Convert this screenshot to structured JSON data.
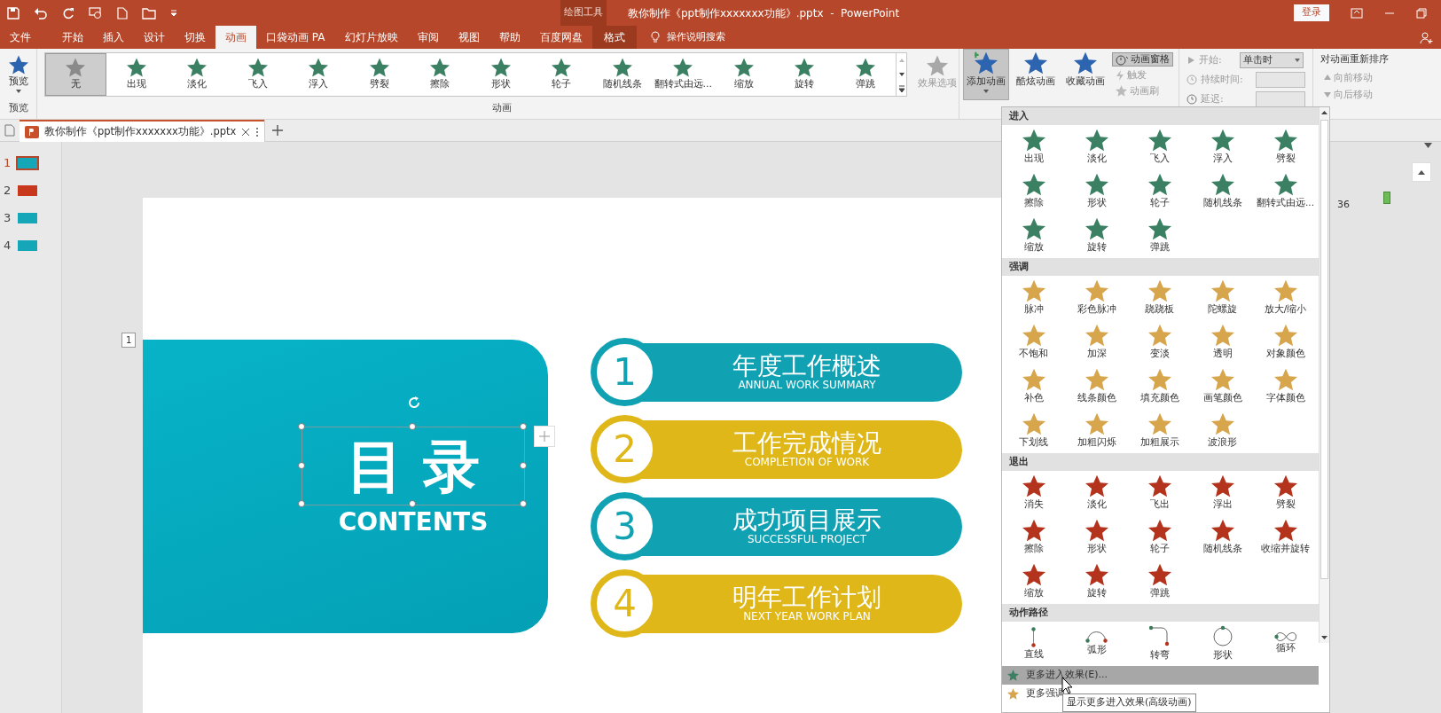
{
  "title_bar": {
    "context_label": "绘图工具",
    "title": "教你制作《ppt制作xxxxxxx功能》.pptx  -  PowerPoint",
    "login": "登录"
  },
  "tabs": [
    {
      "label": "文件",
      "selected": false,
      "kind": "file"
    },
    {
      "label": "开始",
      "selected": false,
      "kind": "normal"
    },
    {
      "label": "插入",
      "selected": false,
      "kind": "normal"
    },
    {
      "label": "设计",
      "selected": false,
      "kind": "normal"
    },
    {
      "label": "切换",
      "selected": false,
      "kind": "normal"
    },
    {
      "label": "动画",
      "selected": true,
      "kind": "normal"
    },
    {
      "label": "口袋动画 PA",
      "selected": false,
      "kind": "normal"
    },
    {
      "label": "幻灯片放映",
      "selected": false,
      "kind": "normal"
    },
    {
      "label": "审阅",
      "selected": false,
      "kind": "normal"
    },
    {
      "label": "视图",
      "selected": false,
      "kind": "normal"
    },
    {
      "label": "帮助",
      "selected": false,
      "kind": "normal"
    },
    {
      "label": "百度网盘",
      "selected": false,
      "kind": "normal"
    },
    {
      "label": "格式",
      "selected": false,
      "kind": "context"
    }
  ],
  "search": "操作说明搜索",
  "ribbon": {
    "preview": "预览",
    "preview_group": "预览",
    "gallery": [
      {
        "label": "无",
        "selected": true,
        "kind": "none"
      },
      {
        "label": "出现",
        "selected": false,
        "kind": "effect"
      },
      {
        "label": "淡化",
        "selected": false,
        "kind": "effect"
      },
      {
        "label": "飞入",
        "selected": false,
        "kind": "effect"
      },
      {
        "label": "浮入",
        "selected": false,
        "kind": "effect"
      },
      {
        "label": "劈裂",
        "selected": false,
        "kind": "effect"
      },
      {
        "label": "擦除",
        "selected": false,
        "kind": "effect"
      },
      {
        "label": "形状",
        "selected": false,
        "kind": "effect"
      },
      {
        "label": "轮子",
        "selected": false,
        "kind": "effect"
      },
      {
        "label": "随机线条",
        "selected": false,
        "kind": "effect"
      },
      {
        "label": "翻转式由远...",
        "selected": false,
        "kind": "effect"
      },
      {
        "label": "缩放",
        "selected": false,
        "kind": "effect"
      },
      {
        "label": "旋转",
        "selected": false,
        "kind": "effect"
      },
      {
        "label": "弹跳",
        "selected": false,
        "kind": "effect"
      }
    ],
    "gallery_group": "动画",
    "effect_options": {
      "label": "效果选项",
      "disabled": true
    },
    "add_animation": {
      "label": "添加动画",
      "selected": true
    },
    "cool_animation": "酷炫动画",
    "favorite_animation": "收藏动画",
    "animation_pane": {
      "label": "动画窗格",
      "selected": true
    },
    "trigger": {
      "label": "触发",
      "disabled": true
    },
    "painter": {
      "label": "动画刷",
      "disabled": true
    },
    "timing": {
      "start_label": "开始:",
      "start_value": "单击时",
      "duration_label": "持续时间:",
      "delay_label": "延迟:"
    },
    "reorder": {
      "title": "对动画重新排序",
      "items": [
        {
          "label": "向前移动",
          "disabled": true,
          "kind": "up"
        },
        {
          "label": "向后移动",
          "disabled": true,
          "kind": "down"
        }
      ]
    }
  },
  "document_tab": {
    "title": "教你制作《ppt制作xxxxxxx功能》.pptx"
  },
  "thumbnails": [
    {
      "number": "1",
      "selected": true,
      "color": "#15a6b8"
    },
    {
      "number": "2",
      "selected": false,
      "color": "#c8381c"
    },
    {
      "number": "3",
      "selected": false,
      "color": "#15a6b8"
    },
    {
      "number": "4",
      "selected": false,
      "color": "#15a6b8"
    }
  ],
  "slide": {
    "number_tag": "1",
    "title": "目 录",
    "subtitle": "CONTENTS",
    "items": [
      {
        "number": "1",
        "title": "年度工作概述",
        "subtitle": "ANNUAL WORK SUMMARY",
        "color": "#10a1b3"
      },
      {
        "number": "2",
        "title": "工作完成情况",
        "subtitle": "COMPLETION OF WORK",
        "color": "#e0b718"
      },
      {
        "number": "3",
        "title": "成功项目展示",
        "subtitle": "SUCCESSFUL PROJECT",
        "color": "#10a1b3"
      },
      {
        "number": "4",
        "title": "明年工作计划",
        "subtitle": "NEXT YEAR WORK PLAN",
        "color": "#e0b718"
      }
    ]
  },
  "side_pane": {
    "value": "36"
  },
  "animation_menu": {
    "sections": [
      {
        "title": "进入",
        "kind": "star",
        "color": "#3b8063",
        "items": [
          "出现",
          "淡化",
          "飞入",
          "浮入",
          "劈裂",
          "擦除",
          "形状",
          "轮子",
          "随机线条",
          "翻转式由远...",
          "缩放",
          "旋转",
          "弹跳"
        ]
      },
      {
        "title": "强调",
        "kind": "star",
        "color": "#d6a54c",
        "items": [
          "脉冲",
          "彩色脉冲",
          "跷跷板",
          "陀螺旋",
          "放大/缩小",
          "不饱和",
          "加深",
          "变淡",
          "透明",
          "对象颜色",
          "补色",
          "线条颜色",
          "填充颜色",
          "画笔颜色",
          "字体颜色",
          "下划线",
          "加粗闪烁",
          "加粗展示",
          "波浪形"
        ]
      },
      {
        "title": "退出",
        "kind": "star",
        "color": "#b3331d",
        "items": [
          "消失",
          "淡化",
          "飞出",
          "浮出",
          "劈裂",
          "擦除",
          "形状",
          "轮子",
          "随机线条",
          "收缩并旋转",
          "缩放",
          "旋转",
          "弹跳"
        ]
      },
      {
        "title": "动作路径",
        "kind": "path",
        "items": [
          "直线",
          "弧形",
          "转弯",
          "形状",
          "循环"
        ]
      }
    ],
    "commands": [
      {
        "label": "更多进入效果(E)...",
        "selected": true,
        "color": "#3b8063"
      },
      {
        "label": "更多强调",
        "selected": false,
        "color": "#d6a54c"
      }
    ],
    "tooltip": "显示更多进入效果(高级动画)"
  }
}
